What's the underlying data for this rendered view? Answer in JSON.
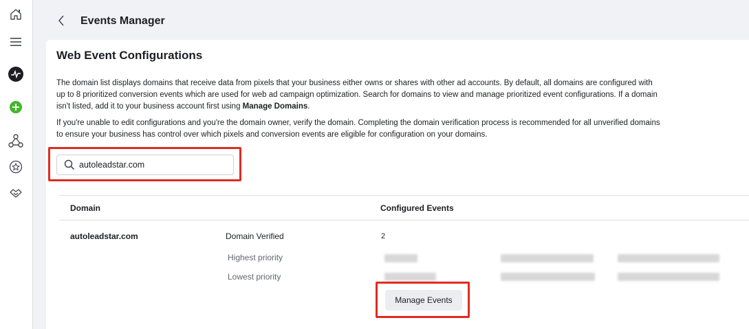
{
  "nav": {
    "icons": [
      "home-icon",
      "menu-icon",
      "analytics-icon",
      "create-icon",
      "events-icon",
      "favorites-icon",
      "partners-icon"
    ]
  },
  "header": {
    "title": "Events Manager"
  },
  "main": {
    "title": "Web Event Configurations",
    "paragraph1_part1": "The domain list displays domains that receive data from pixels that your business either owns or shares with other ad accounts. By default, all domains are configured with up to 8 prioritized conversion events which are used for web ad campaign optimization. Search for domains to view and manage prioritized event configurations. If a domain isn't listed, add it to your business account first using ",
    "paragraph1_bold": "Manage Domains",
    "paragraph1_end": ".",
    "paragraph2": "If you're unable to edit configurations and you're the domain owner, verify the domain. Completing the domain verification process is recommended for all unverified domains to ensure your business has control over which pixels and conversion events are eligible for configuration on your domains.",
    "search": {
      "value": "autoleadstar.com"
    },
    "table": {
      "headers": {
        "domain": "Domain",
        "configured_events": "Configured Events"
      },
      "row": {
        "domain": "autoleadstar.com",
        "status": "Domain Verified",
        "count": "2",
        "highest_label": "Highest priority",
        "lowest_label": "Lowest priority"
      }
    },
    "manage_events_label": "Manage Events"
  }
}
